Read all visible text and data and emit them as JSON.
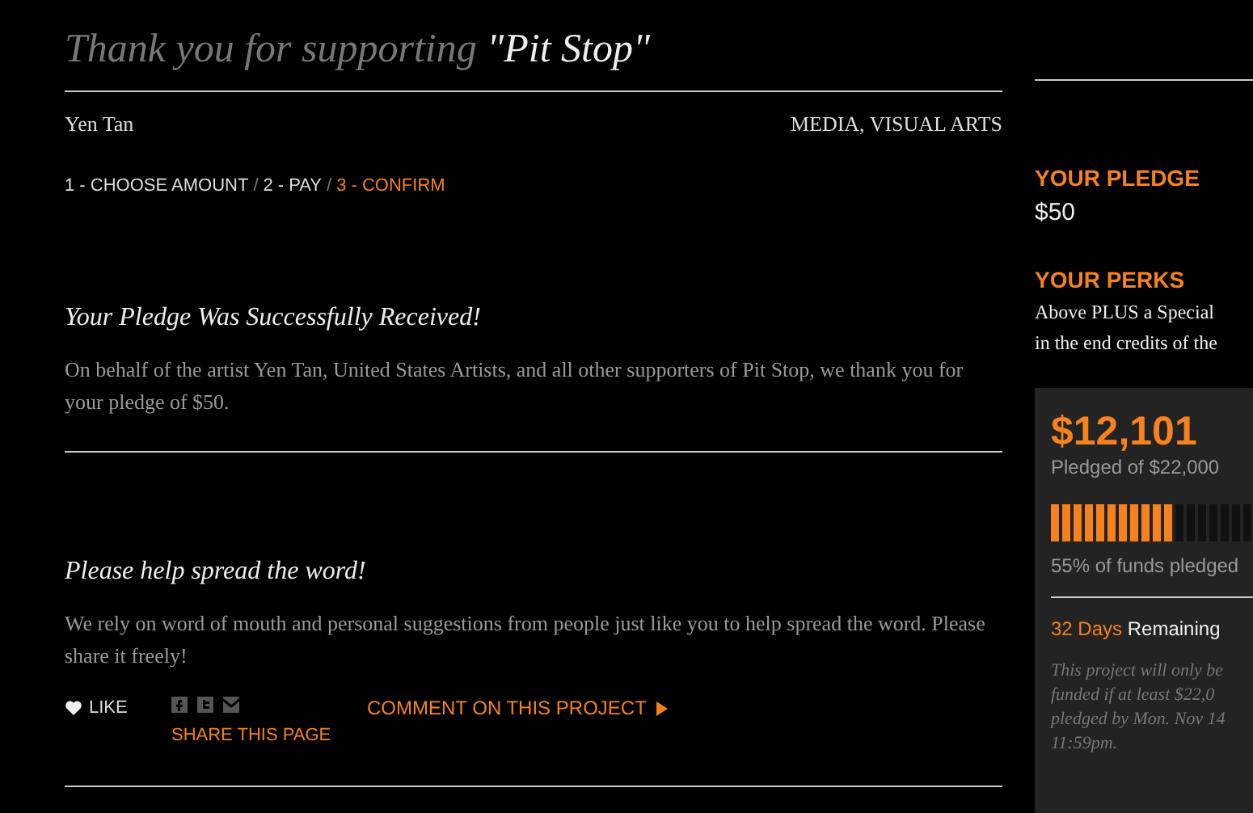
{
  "header": {
    "title": "Thank you for supporting",
    "project": "\"Pit Stop\"",
    "artist": "Yen Tan",
    "category": "MEDIA, VISUAL ARTS"
  },
  "steps": [
    {
      "label": "1 - CHOOSE AMOUNT",
      "selected": false
    },
    {
      "label": "2 - PAY",
      "selected": false
    },
    {
      "label": "3 - CONFIRM",
      "selected": true
    }
  ],
  "step_separator": "/",
  "confirmation": {
    "heading": "Your Pledge Was Successfully Received!",
    "body": "On behalf of the artist Yen Tan, United States Artists, and all other supporters of Pit Stop, we thank you for your pledge of $50."
  },
  "share": {
    "heading": "Please help spread the word!",
    "body": "We rely on word of mouth and personal suggestions from people just like you to help spread the word. Please share it freely!",
    "like": "LIKE",
    "share_label": "SHARE THIS PAGE",
    "comment": "COMMENT ON THIS PROJECT"
  },
  "sidebar": {
    "pledge_heading": "YOUR PLEDGE",
    "pledge": "$50",
    "perks_heading": "YOUR PERKS",
    "perks_lines": [
      "Above PLUS a Special",
      "in the end credits of the"
    ],
    "funding": {
      "amount": "$12,101",
      "goal": "Pledged of $22,000",
      "level": 0.55,
      "percent": "55% of funds pledged",
      "days": "32 Days",
      "remaining": "Remaining",
      "note_lines": [
        "This project will only be",
        "funded if at least $22,0",
        "pledged by Mon. Nov 14",
        "11:59pm."
      ]
    }
  }
}
